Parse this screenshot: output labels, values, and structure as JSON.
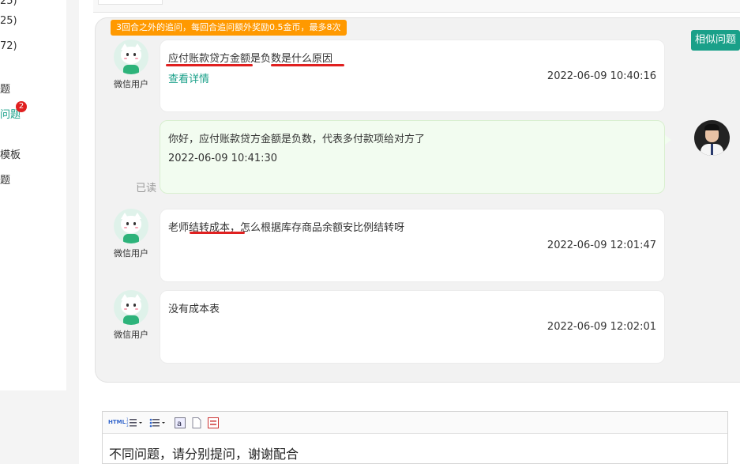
{
  "sidebar": {
    "items": [
      {
        "label": "25)"
      },
      {
        "label": "72)"
      },
      {
        "label": "题"
      },
      {
        "label": "问题"
      },
      {
        "label": "模板"
      },
      {
        "label": "题"
      }
    ],
    "badge": "2"
  },
  "notice": "3回合之外的追问，每回合追问额外奖励0.5金币，最多8次",
  "similar_button": "相似问题",
  "messages": [
    {
      "user": "微信用户",
      "text": "应付账款贷方金额是负数是什么原因",
      "link": "查看详情",
      "time": "2022-06-09 10:40:16"
    },
    {
      "text": "你好，应付账款贷方金额是负数，代表多付款项给对方了",
      "time": "2022-06-09 10:41:30",
      "status": "已读"
    },
    {
      "user": "微信用户",
      "text": "老师结转成本，怎么根据库存商品余额安比例结转呀",
      "time": "2022-06-09 12:01:47"
    },
    {
      "user": "微信用户",
      "text": "没有成本表",
      "time": "2022-06-09 12:02:01"
    }
  ],
  "editor": {
    "toolbar": {
      "html": "HTML",
      "ordered_list": "ordered-list-icon",
      "unordered_list": "unordered-list-icon",
      "link": "a",
      "page": "page-icon",
      "block": "block-icon"
    },
    "content": "不同问题，请分别提问，谢谢配合"
  },
  "colors": {
    "accent": "#1aa089",
    "notice": "#ff9900",
    "badge": "#e02020",
    "underline": "#e02020"
  }
}
